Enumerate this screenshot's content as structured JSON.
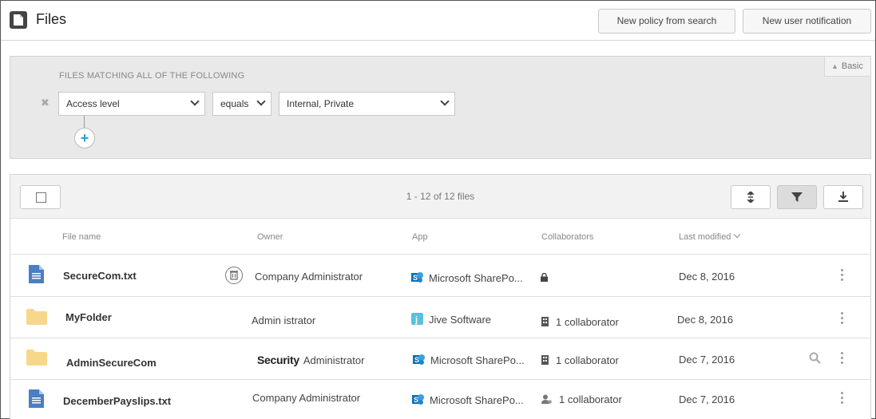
{
  "header": {
    "title": "Files",
    "buttons": {
      "new_policy": "New policy from search",
      "new_notification": "New user notification"
    }
  },
  "filter": {
    "heading": "FILES MATCHING ALL OF THE FOLLOWING",
    "basic_label": "Basic",
    "field": "Access level",
    "operator": "equals",
    "value": "Internal, Private"
  },
  "table": {
    "count_text": "1 - 12 of 12 files",
    "columns": {
      "file_name": "File name",
      "owner": "Owner",
      "app": "App",
      "collaborators": "Collaborators",
      "last_modified": "Last modified"
    },
    "rows": [
      {
        "type": "document",
        "name": "SecureCom.txt",
        "owner": "Company Administrator",
        "app": "Microsoft SharePo...",
        "app_icon": "sharepoint-icon",
        "collaborators": "",
        "collab_icon": "lock-icon",
        "modified": "Dec 8, 2016"
      },
      {
        "type": "folder",
        "name": "MyFolder",
        "owner": "Admin istrator",
        "app": "Jive Software",
        "app_icon": "jive-icon",
        "collaborators": "1 collaborator",
        "collab_icon": "building-icon",
        "modified": "Dec 8, 2016"
      },
      {
        "type": "folder",
        "name": "AdminSecureCom",
        "owner_prefix": "Security",
        "owner": "Administrator",
        "app": "Microsoft SharePo...",
        "app_icon": "sharepoint-icon",
        "collaborators": "1 collaborator",
        "collab_icon": "building-icon",
        "modified": "Dec 7, 2016"
      },
      {
        "type": "document",
        "name": "DecemberPayslips.txt",
        "owner": "Company Administrator",
        "app": "Microsoft SharePo...",
        "app_icon": "sharepoint-icon",
        "collaborators": "1 collaborator",
        "collab_icon": "person-icon",
        "modified": "Dec 7, 2016"
      }
    ]
  },
  "colors": {
    "doc_blue": "#4a7fc1",
    "folder_yellow": "#f7d88a",
    "sharepoint_blue": "#0b6fb8",
    "jive_teal": "#5bc0de",
    "add_blue": "#2a9fd6"
  }
}
